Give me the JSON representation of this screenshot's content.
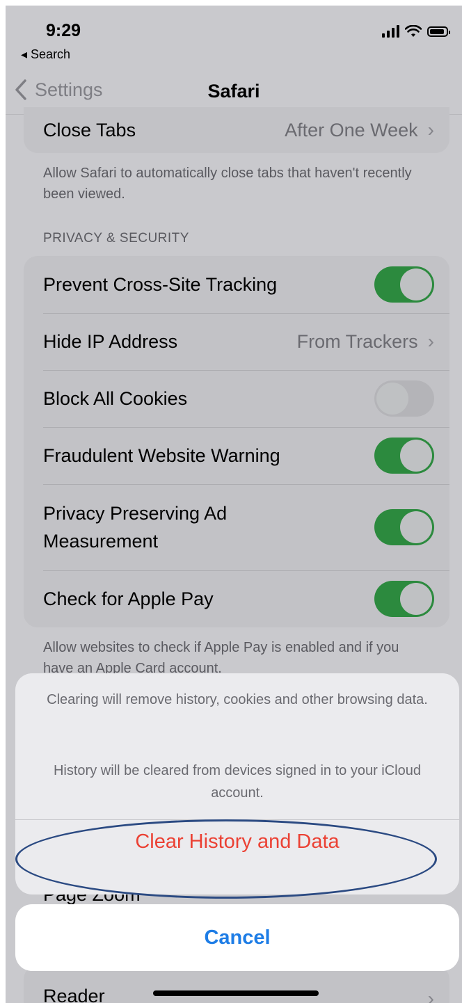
{
  "status_bar": {
    "time": "9:29",
    "back_app": "◂ Search"
  },
  "nav": {
    "back_label": "Settings",
    "title": "Safari"
  },
  "tabs_section": {
    "close_tabs_label": "Close Tabs",
    "close_tabs_value": "After One Week",
    "footnote": "Allow Safari to automatically close tabs that haven't recently been viewed."
  },
  "privacy_section": {
    "header": "PRIVACY & SECURITY",
    "rows": [
      {
        "label": "Prevent Cross-Site Tracking",
        "toggle": true
      },
      {
        "label": "Hide IP Address",
        "value": "From Trackers"
      },
      {
        "label": "Block All Cookies",
        "toggle": false
      },
      {
        "label": "Fraudulent Website Warning",
        "toggle": true
      },
      {
        "label": "Privacy Preserving Ad Measurement",
        "toggle": true
      },
      {
        "label": "Check for Apple Pay",
        "toggle": true
      }
    ],
    "footnote": "Allow websites to check if Apple Pay is enabled and if you have an Apple Card account."
  },
  "action_sheet": {
    "message_1": "Clearing will remove history, cookies and other browsing data.",
    "message_2": "History will be cleared from devices signed in to your iCloud account.",
    "destructive_action": "Clear History and Data",
    "cancel": "Cancel"
  },
  "behind_sheet": {
    "partial_row": "Page Zoom",
    "reader_row": "Reader"
  },
  "colors": {
    "toggle_on": "#2c8a3e",
    "destructive": "#eb4134",
    "cancel_blue": "#1e7de6",
    "annotation_oval": "#2b4a82"
  }
}
